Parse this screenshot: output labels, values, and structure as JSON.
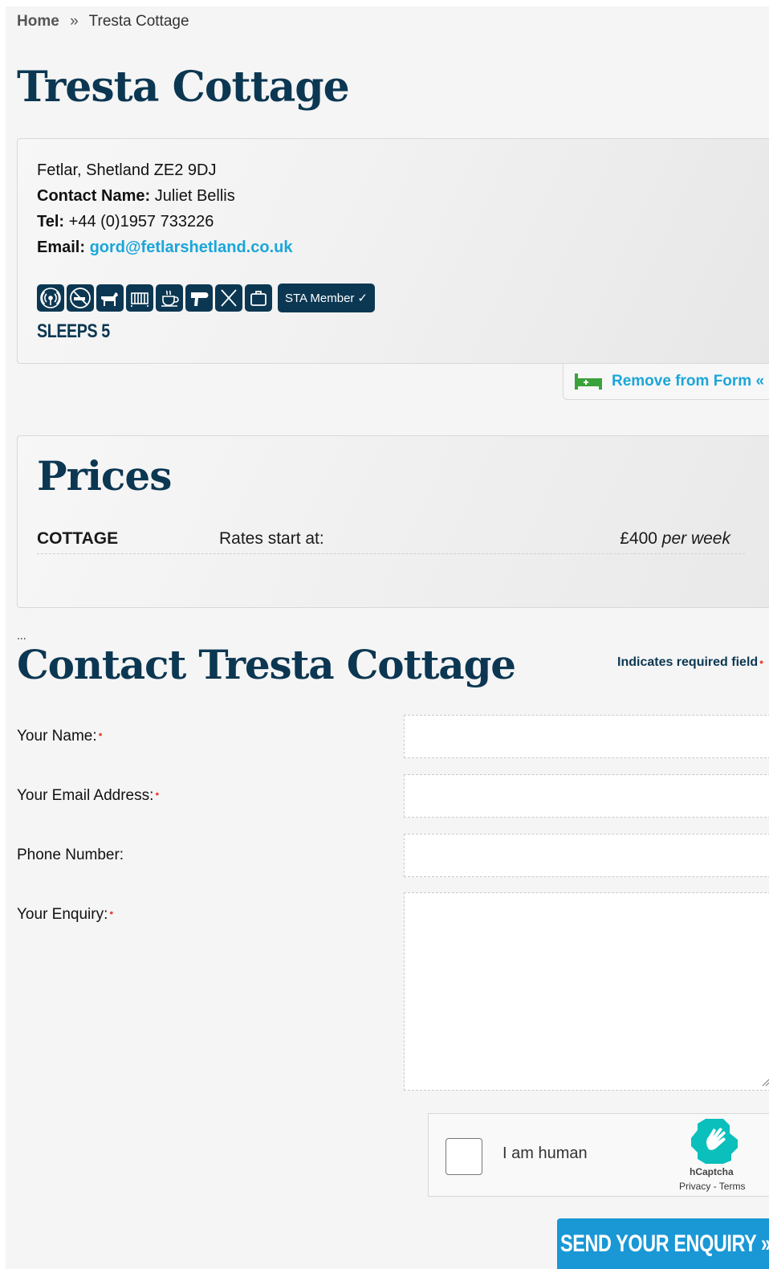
{
  "breadcrumb": {
    "home": "Home",
    "separator": "»",
    "current": "Tresta Cottage"
  },
  "page_title": "Tresta Cottage",
  "info": {
    "address": "Fetlar, Shetland ZE2 9DJ",
    "contact_label": "Contact Name:",
    "contact_name": "Juliet Bellis",
    "tel_label": "Tel:",
    "tel": "+44 (0)1957 733226",
    "email_label": "Email:",
    "email": "gord@fetlarshetland.co.uk",
    "amenity_icons": [
      "wifi-icon",
      "no-smoking-icon",
      "dog-icon",
      "cot-icon",
      "tea-cup-icon",
      "hairdryer-icon",
      "cutlery-icon",
      "suitcase-icon"
    ],
    "sta_badge": "STA Member",
    "sta_check": "✓",
    "sleeps": "SLEEPS 5"
  },
  "remove_button": {
    "label": "Remove from Form «",
    "icon": "bed-icon"
  },
  "prices": {
    "heading": "Prices",
    "rows": [
      {
        "type": "COTTAGE",
        "rates_label": "Rates start at:",
        "amount": "£400",
        "period": "per week"
      }
    ]
  },
  "contact": {
    "ellipsis": "...",
    "heading": "Contact Tresta Cottage",
    "required_note": "Indicates required field",
    "required_marker": "•",
    "fields": {
      "name_label": "Your Name:",
      "email_label": "Your Email Address:",
      "phone_label": "Phone Number:",
      "enquiry_label": "Your Enquiry:"
    }
  },
  "captcha": {
    "label": "I am human",
    "brand": "hCaptcha",
    "legal": "Privacy - Terms"
  },
  "submit": {
    "label": "SEND YOUR ENQUIRY »"
  },
  "colors": {
    "brand_navy": "#0c3752",
    "link_blue": "#1aa6d9",
    "button_blue": "#1a97d5",
    "required_red": "#e8483d"
  }
}
